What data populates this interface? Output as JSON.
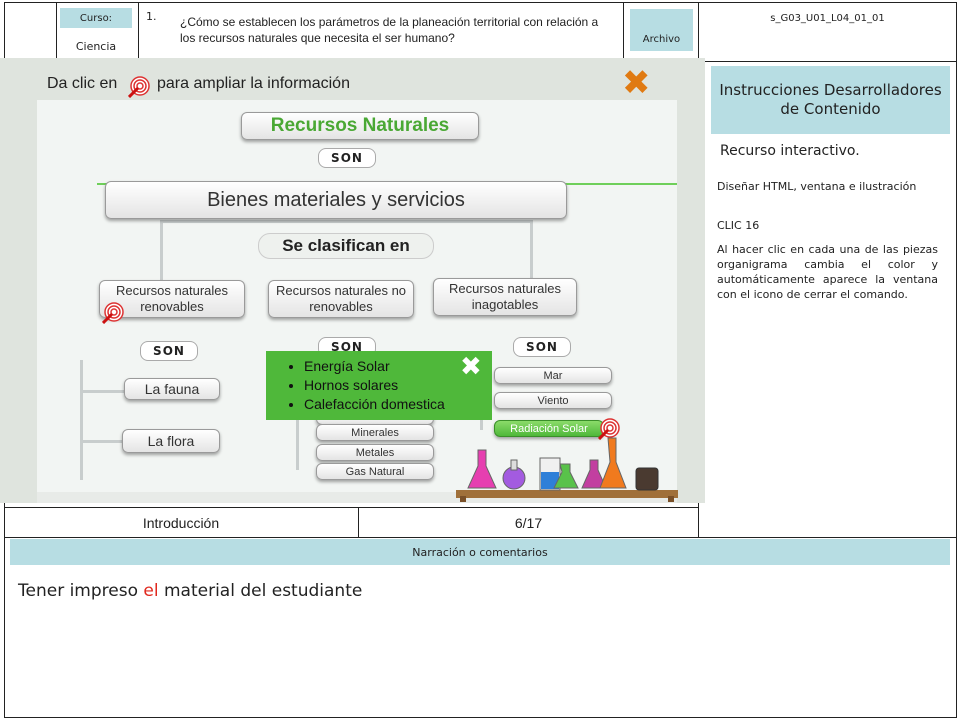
{
  "header": {
    "curso_label": "Curso:",
    "course": "Ciencia",
    "question_number": "1.",
    "question": "¿Cómo se establecen los parámetros de la planeación territorial con relación a los recursos naturales que necesita el ser humano?",
    "archivo_label": "Archivo",
    "code": "s_G03_U01_L04_01_01"
  },
  "slide": {
    "hint_prefix": "Da clic en",
    "hint_suffix": "para ampliar la información",
    "title": "Recursos Naturales",
    "son": "SON",
    "bienes": "Bienes materiales y servicios",
    "clasifican": "Se clasifican en",
    "categories": [
      "Recursos naturales renovables",
      "Recursos naturales no renovables",
      "Recursos naturales inagotables"
    ],
    "renovables_items": [
      "La fauna",
      "La flora"
    ],
    "no_renovables_items": [
      "Minerales",
      "Metales",
      "Gas Natural"
    ],
    "inagotables_items": [
      "Mar",
      "Viento",
      "Radiación Solar"
    ],
    "popup_items": [
      "Energía Solar",
      "Hornos solares",
      "Calefacción domestica"
    ],
    "colors": {
      "accent_green": "#4aa834",
      "close_orange": "#e07a12",
      "popup_bg": "#4fb83a",
      "overlay_bg": "#dde2dc"
    }
  },
  "footer_row": {
    "section": "Introducción",
    "page": "6/17"
  },
  "instructions": {
    "title": "Instrucciones Desarrolladores de Contenido",
    "resource": "Recurso interactivo.",
    "design": "Diseñar HTML, ventana e ilustración",
    "clic": "CLIC 16",
    "description": "Al hacer clic en cada una de las piezas organigrama cambia el color y automáticamente aparece la ventana con el icono de cerrar el comando."
  },
  "narration": {
    "label": "Narración o comentarios",
    "text_before": "Tener impreso ",
    "text_highlight": "el",
    "text_after": " material del estudiante"
  }
}
